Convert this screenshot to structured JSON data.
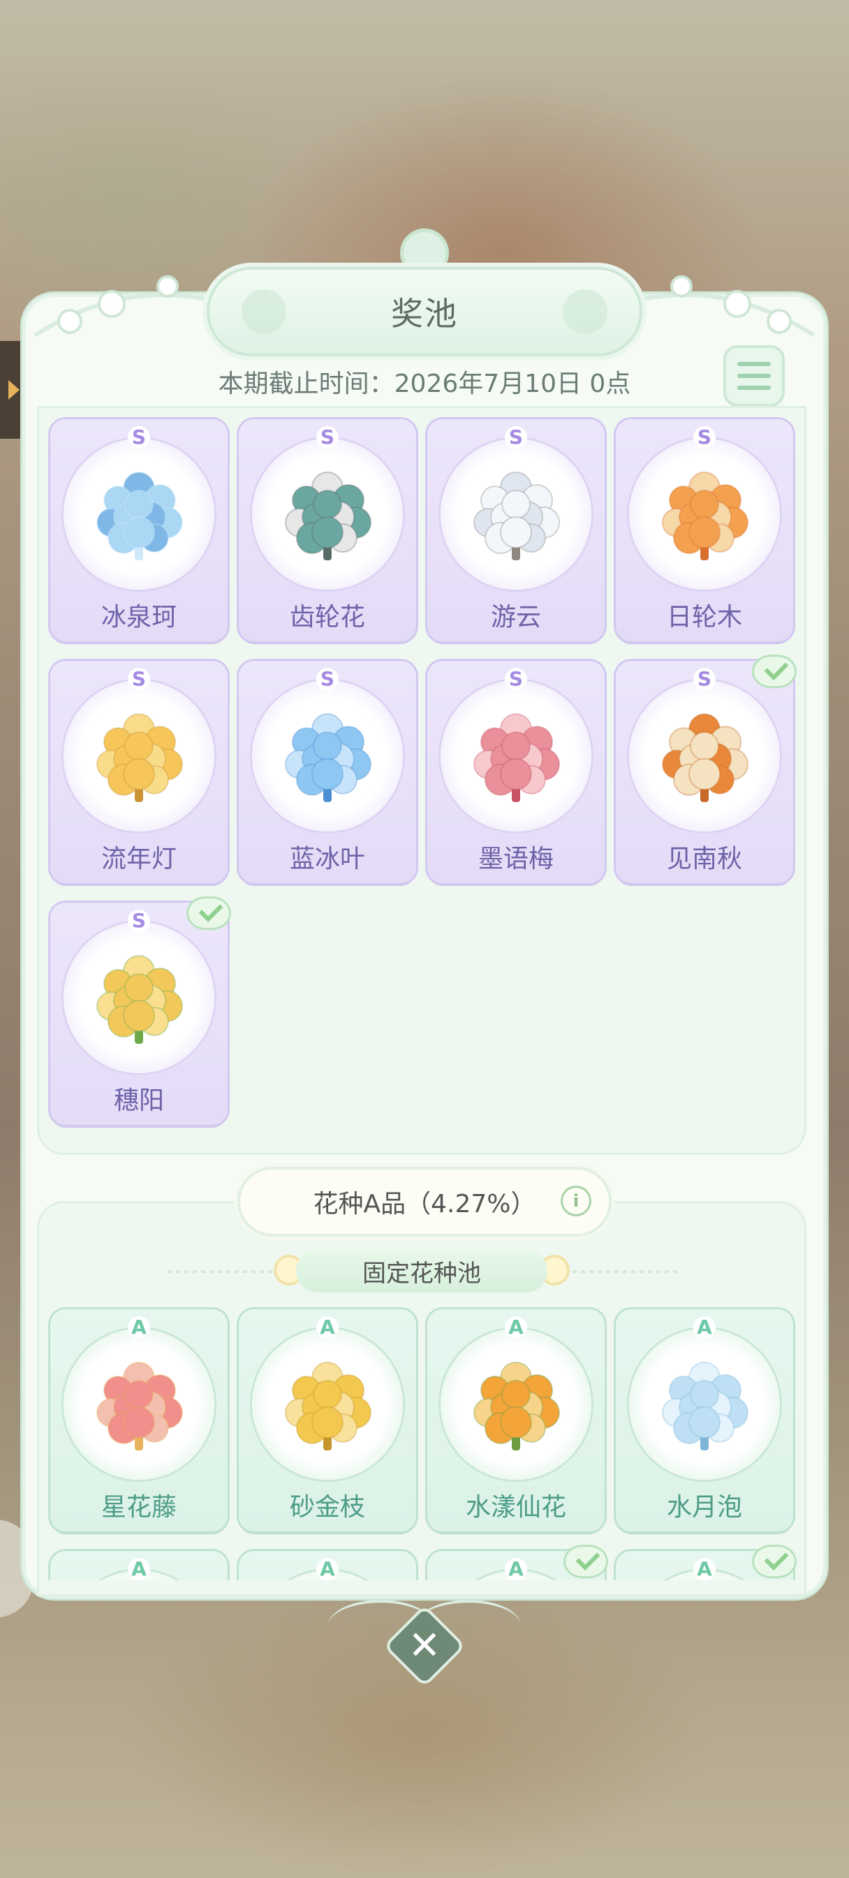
{
  "title": "奖池",
  "deadline": "本期截止时间：2026年7月10日 0点",
  "s_items": [
    {
      "grade": "S",
      "name": "冰泉珂",
      "owned": false,
      "art": "ice-cloud-tree-icon"
    },
    {
      "grade": "S",
      "name": "齿轮花",
      "owned": false,
      "art": "gear-flower-tree-icon"
    },
    {
      "grade": "S",
      "name": "游云",
      "owned": false,
      "art": "cloud-tree-icon"
    },
    {
      "grade": "S",
      "name": "日轮木",
      "owned": false,
      "art": "sun-wheel-tree-icon"
    },
    {
      "grade": "S",
      "name": "流年灯",
      "owned": false,
      "art": "golden-lantern-tree-icon"
    },
    {
      "grade": "S",
      "name": "蓝冰叶",
      "owned": false,
      "art": "blue-ice-leaf-tree-icon"
    },
    {
      "grade": "S",
      "name": "墨语梅",
      "owned": false,
      "art": "plum-blossom-tree-icon"
    },
    {
      "grade": "S",
      "name": "见南秋",
      "owned": true,
      "art": "pumpkin-rose-tree-icon"
    },
    {
      "grade": "S",
      "name": "穗阳",
      "owned": true,
      "art": "golden-ball-tree-icon"
    }
  ],
  "tier_label": "花种A品（4.27%）",
  "info_icon": "i",
  "pool_label": "固定花种池",
  "a_items": [
    {
      "grade": "A",
      "name": "星花藤",
      "owned": false,
      "art": "heart-vine-icon"
    },
    {
      "grade": "A",
      "name": "砂金枝",
      "owned": false,
      "art": "golden-star-leaf-icon"
    },
    {
      "grade": "A",
      "name": "水漾仙花",
      "owned": false,
      "art": "orange-lily-bush-icon"
    },
    {
      "grade": "A",
      "name": "水月泡",
      "owned": false,
      "art": "bubble-tree-icon"
    },
    {
      "grade": "A",
      "name": "",
      "owned": false,
      "art": "hidden-item-icon"
    },
    {
      "grade": "A",
      "name": "",
      "owned": false,
      "art": "hidden-item-icon"
    },
    {
      "grade": "A",
      "name": "",
      "owned": true,
      "art": "hidden-item-icon"
    },
    {
      "grade": "A",
      "name": "",
      "owned": true,
      "art": "hidden-item-icon"
    }
  ],
  "close_symbol": "✕",
  "colors": {
    "accent": "#9ed1af",
    "s_card": "#e6def9",
    "a_card": "#dff3e9",
    "check": "#8fd08f"
  }
}
